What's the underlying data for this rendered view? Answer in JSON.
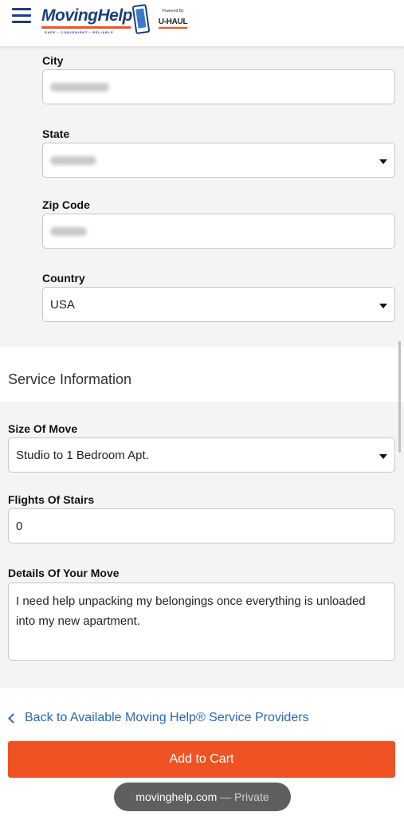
{
  "header": {
    "logo_text": "MovingHelp",
    "logo_tagline": "SAFE • CONVENIENT • RELIABLE",
    "powered_by": "Powered By",
    "uhaul": "U-HAUL"
  },
  "address": {
    "city_label": "City",
    "state_label": "State",
    "zip_label": "Zip Code",
    "country_label": "Country",
    "country_value": "USA"
  },
  "service": {
    "section_title": "Service Information",
    "size_label": "Size Of Move",
    "size_value": "Studio to 1 Bedroom Apt.",
    "stairs_label": "Flights Of Stairs",
    "stairs_value": "0",
    "details_label": "Details Of Your Move",
    "details_value": "I need help unpacking my belongings once everything is unloaded into my new apartment."
  },
  "actions": {
    "back_link": "Back to Available Moving Help® Service Providers",
    "add_to_cart": "Add to Cart"
  },
  "browser": {
    "domain": "movinghelp.com",
    "mode": "— Private"
  },
  "colors": {
    "brand_blue": "#1d3f7a",
    "accent_orange": "#f05323",
    "link_blue": "#2a66b3"
  }
}
